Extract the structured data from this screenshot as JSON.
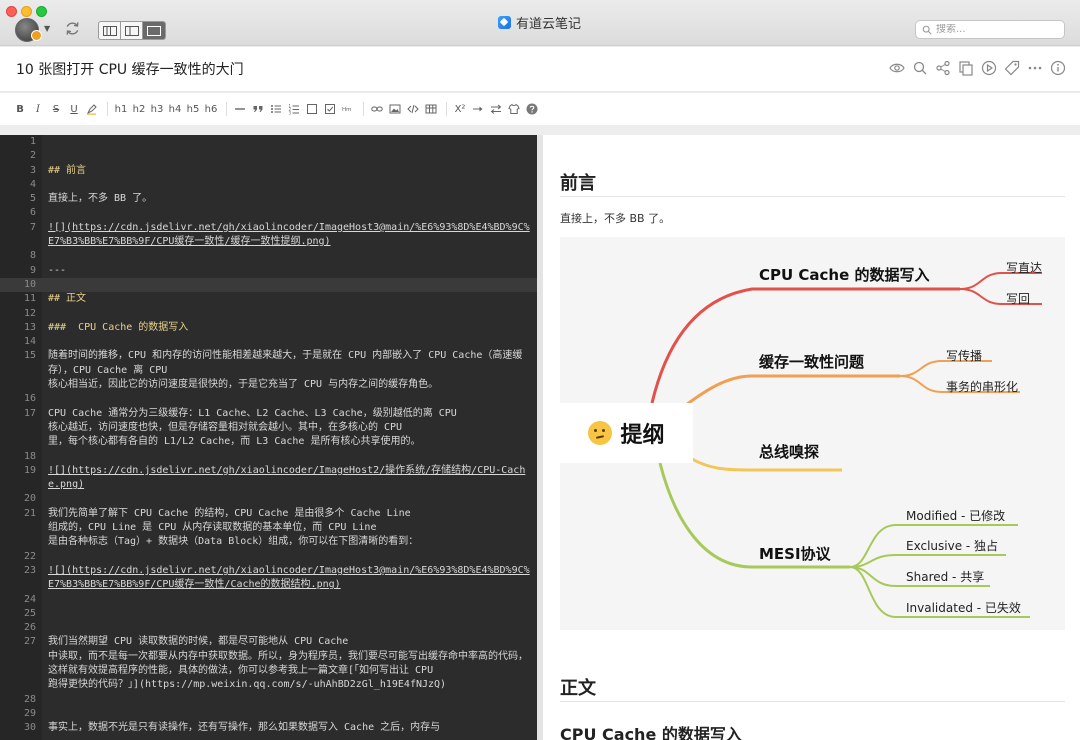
{
  "window": {
    "app_title": "有道云笔记",
    "search_placeholder": "搜索..."
  },
  "note": {
    "title": "10 张图打开 CPU 缓存一致性的大门"
  },
  "toolbar": {
    "bold": "B",
    "italic": "I",
    "strike": "S",
    "underline": "U",
    "h1": "h1",
    "h2": "h2",
    "h3": "h3",
    "h4": "h4",
    "h5": "h5",
    "h6": "h6",
    "superscript": "X²"
  },
  "editor": {
    "current_line": "10",
    "lines": [
      {
        "n": "1",
        "t": ""
      },
      {
        "n": "2",
        "t": ""
      },
      {
        "n": "3",
        "t": "## 前言",
        "kind": "heading"
      },
      {
        "n": "4",
        "t": ""
      },
      {
        "n": "5",
        "t": "直接上，不多 BB 了。"
      },
      {
        "n": "6",
        "t": ""
      },
      {
        "n": "7",
        "t": "![](https://cdn.jsdelivr.net/gh/xiaolincoder/ImageHost3@main/%E6%93%8D%E4%BD%9C%E7%B3%BB%E7%BB%9F/CPU缓存一致性/缓存一致性提纲.png)",
        "kind": "link"
      },
      {
        "n": "8",
        "t": ""
      },
      {
        "n": "9",
        "t": "---"
      },
      {
        "n": "10",
        "t": ""
      },
      {
        "n": "11",
        "t": "## 正文",
        "kind": "heading"
      },
      {
        "n": "12",
        "t": ""
      },
      {
        "n": "13",
        "t": "###  CPU Cache 的数据写入",
        "kind": "heading"
      },
      {
        "n": "14",
        "t": ""
      },
      {
        "n": "15",
        "t": "随着时间的推移，CPU 和内存的访问性能相差越来越大，于是就在 CPU 内部嵌入了 CPU Cache（高速缓存），CPU Cache 离 CPU\n核心相当近，因此它的访问速度是很快的，于是它充当了 CPU 与内存之间的缓存角色。"
      },
      {
        "n": "16",
        "t": ""
      },
      {
        "n": "17",
        "t": "CPU Cache 通常分为三级缓存：L1 Cache、L2 Cache、L3 Cache，级别越低的离 CPU\n核心越近，访问速度也快，但是存储容量相对就会越小。其中，在多核心的 CPU\n里，每个核心都有各自的 L1/L2 Cache，而 L3 Cache 是所有核心共享使用的。"
      },
      {
        "n": "18",
        "t": ""
      },
      {
        "n": "19",
        "t": "![](https://cdn.jsdelivr.net/gh/xiaolincoder/ImageHost2/操作系统/存储结构/CPU-Cache.png)",
        "kind": "link"
      },
      {
        "n": "20",
        "t": ""
      },
      {
        "n": "21",
        "t": "我们先简单了解下 CPU Cache 的结构，CPU Cache 是由很多个 Cache Line\n组成的，CPU Line 是 CPU 从内存读取数据的基本单位，而 CPU Line\n是由各种标志（Tag）+ 数据块（Data Block）组成，你可以在下图清晰的看到："
      },
      {
        "n": "22",
        "t": ""
      },
      {
        "n": "23",
        "t": "![](https://cdn.jsdelivr.net/gh/xiaolincoder/ImageHost3@main/%E6%93%8D%E4%BD%9C%E7%B3%BB%E7%BB%9F/CPU缓存一致性/Cache的数据结构.png)",
        "kind": "link"
      },
      {
        "n": "24",
        "t": ""
      },
      {
        "n": "25",
        "t": ""
      },
      {
        "n": "26",
        "t": ""
      },
      {
        "n": "27",
        "t": "我们当然期望 CPU 读取数据的时候，都是尽可能地从 CPU Cache\n中读取，而不是每一次都要从内存中获取数据。所以，身为程序员，我们要尽可能写出缓存命中率高的代码，这样就有效提高程序的性能，具体的做法，你可以参考我上一篇文章[「如何写出让 CPU\n跑得更快的代码？」](https://mp.weixin.qq.com/s/-uhAhBD2zGl_h19E4fNJzQ)"
      },
      {
        "n": "28",
        "t": ""
      },
      {
        "n": "29",
        "t": ""
      },
      {
        "n": "30",
        "t": "事实上，数据不光是只有读操作，还有写操作，那么如果数据写入 Cache 之后，内存与"
      }
    ]
  },
  "preview": {
    "intro_heading": "前言",
    "intro_text": "直接上，不多 BB 了。",
    "body_heading": "正文",
    "sub_heading": "CPU Cache 的数据写入",
    "mindmap": {
      "center": "提纲",
      "branches": [
        {
          "label": "CPU Cache 的数据写入",
          "color": "#e0524a",
          "leaves": [
            "写直达",
            "写回"
          ]
        },
        {
          "label": "缓存一致性问题",
          "color": "#f0a050",
          "leaves": [
            "写传播",
            "事务的串形化"
          ]
        },
        {
          "label": "总线嗅探",
          "color": "#f2c659",
          "leaves": []
        },
        {
          "label": "MESI协议",
          "color": "#a7c95a",
          "leaves": [
            "Modified - 已修改",
            "Exclusive - 独占",
            "Shared - 共享",
            "Invalidated - 已失效"
          ]
        }
      ]
    }
  }
}
